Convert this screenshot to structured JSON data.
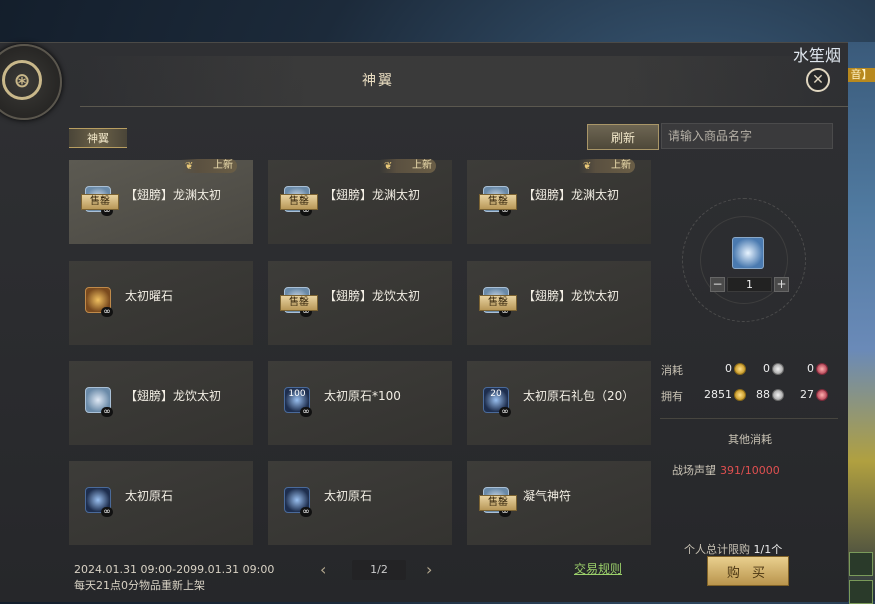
{
  "window": {
    "title": "神翼",
    "close_icon": "close-icon",
    "top_right_label": "水笙烟",
    "strip_badge": "音】"
  },
  "category_tab": {
    "label": "神翼"
  },
  "toolbar": {
    "refresh_label": "刷新",
    "search_placeholder": "请输入商品名字"
  },
  "items": [
    {
      "name": "【翅膀】龙渊太初",
      "new_label": "上新",
      "sold_label": "售罄",
      "icon": "wing-icon"
    },
    {
      "name": "【翅膀】龙渊太初",
      "new_label": "上新",
      "sold_label": "售罄",
      "icon": "wing-icon"
    },
    {
      "name": "【翅膀】龙渊太初",
      "new_label": "上新",
      "sold_label": "售罄",
      "icon": "wing-icon"
    },
    {
      "name": "太初曜石",
      "icon": "ore-icon"
    },
    {
      "name": "【翅膀】龙饮太初",
      "sold_label": "售罄",
      "icon": "wing-icon"
    },
    {
      "name": "【翅膀】龙饮太初",
      "sold_label": "售罄",
      "icon": "wing-icon"
    },
    {
      "name": "【翅膀】龙饮太初",
      "icon": "wing-icon"
    },
    {
      "name": "太初原石*100",
      "icon": "crystal-icon",
      "icon_label": "100"
    },
    {
      "name": "太初原石礼包（20）",
      "icon": "crystal-icon",
      "icon_label": "20"
    },
    {
      "name": "太初原石",
      "icon": "crystal-icon"
    },
    {
      "name": "太初原石",
      "icon": "crystal-icon"
    },
    {
      "name": "凝气神符",
      "sold_label": "售罄",
      "icon": "talisman-icon"
    }
  ],
  "infinite_symbol": "∞",
  "side_panel": {
    "quantity": "1",
    "minus_label": "−",
    "plus_label": "+",
    "cost_label": "消耗",
    "cost": {
      "gold": "0",
      "silver": "0",
      "red": "0"
    },
    "own_label": "拥有",
    "own": {
      "gold": "2851",
      "silver": "88",
      "red": "27"
    },
    "other_cost_title": "其他消耗",
    "honor_label": "战场声望",
    "honor_value": "391/10000",
    "limit_label": "个人总计限购",
    "limit_value": "1/1个",
    "buy_label": "购 买",
    "colors": {
      "honor": "#e05050",
      "buy": "#e9cf8e"
    }
  },
  "pager": {
    "prev_icon": "‹",
    "next_icon": "›",
    "text": "1/2"
  },
  "footer": {
    "rules_link": "交易规则",
    "time_range": "2024.01.31 09:00-2099.01.31 09:00",
    "restock_note": "每天21点0分物品重新上架"
  }
}
